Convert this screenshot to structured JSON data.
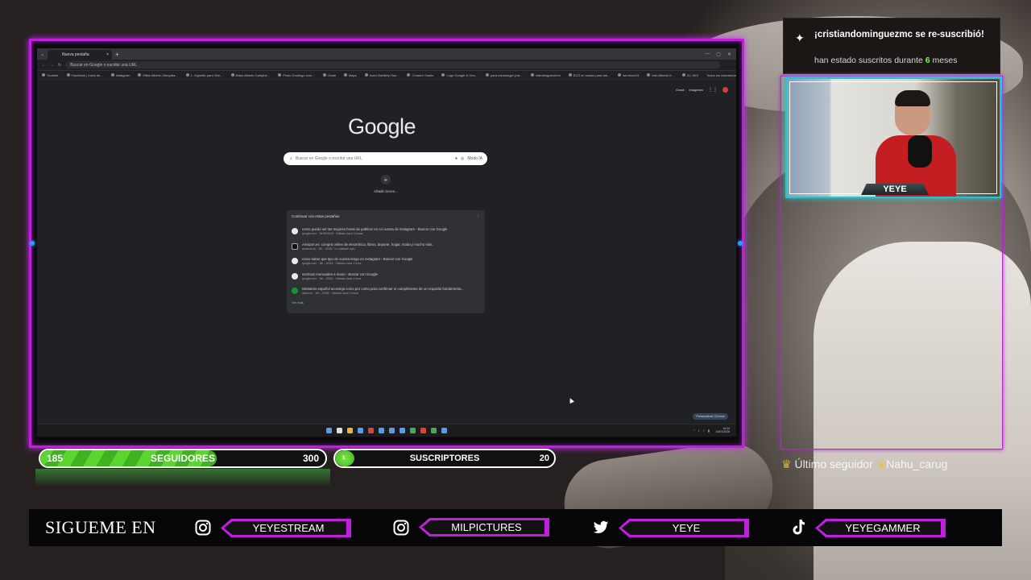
{
  "browser": {
    "tab_title": "Nueva pestaña",
    "omnibox_placeholder": "Buscar en Google o escribir una URL",
    "bookmarks": [
      "Youtube",
      "Facebook | Inicio de...",
      "Instagram",
      "Milan Alberto Zampala...",
      "1. Vignette para Stre...",
      "Milan Alberto Campbe...",
      "Photo Duolingo Icon...",
      "Gmail",
      "Maps",
      "Actor Bartleby Hus...",
      "Creador Studio",
      "Logo Google & Goo...",
      "para messenger pos...",
      "elamarsgaenenm",
      "ECS en ocasio para tak...",
      "servicios19",
      "Iván Alberto Il...",
      "DJ, MCl"
    ],
    "all_bookmarks": "Todos los marcadores",
    "google_links": [
      "Gmail",
      "Imágenes"
    ],
    "logo": "Google",
    "search_placeholder": "Buscar en Google o escribir una URL",
    "mode_chip": "Modo IA",
    "add_shortcut": "Añadir acces...",
    "continue_title": "Continuar con estas pestañas",
    "history": [
      {
        "title": "como puedo ver las mejores horas de publicar en mi cuenta de instagram - Buscar con Google",
        "sub": "google.com · 16:05/2026 · Visitado hace 3 horas"
      },
      {
        "title": "Amazon.es: compra online de electrónica, libros, deporte, hogar, moda y mucho más.",
        "sub": "amazon.es · 16/…/2026 · Lo visitaste ayer"
      },
      {
        "title": "como saber que tipo de cuenta tengo en instagram - Buscar con Google",
        "sub": "google.com · 16/…/2026 · Visitado hace 1 hora"
      },
      {
        "title": "sonrisas mensuales a mano - Buscar con Google",
        "sub": "google.com · 16/…/2026 · Visitado hace 1 hora"
      },
      {
        "title": "Ministerio español aconseja como por como para confirmar el cumplimiento de un requisito fundamenta...",
        "sub": "diario.es · 16/…/2026 · Visitado hace 2 horas"
      }
    ],
    "see_more": "Ver más",
    "customize": "Personalizar Chrome",
    "clock_time": "14:24",
    "clock_date": "14/01/2026"
  },
  "notification": {
    "star_icon": "sparkle-icon",
    "title": "¡cristiandominguezmc se re-suscribió!",
    "prefix": "han estado suscritos durante",
    "months": "6",
    "suffix": "meses"
  },
  "webcam": {
    "nameplate": "YEYE"
  },
  "last_follower": {
    "label": "Último seguidor",
    "name": "Nahu_carug"
  },
  "goals": {
    "followers": {
      "current": "185",
      "label": "SEGUIDORES",
      "target": "300",
      "progress": 0.62
    },
    "subs": {
      "current": "1",
      "label": "SUSCRIPTORES",
      "target": "20",
      "progress": 0.05
    }
  },
  "social": {
    "heading": "SIGUEME EN",
    "accounts": [
      {
        "icon": "instagram-icon",
        "handle": "YEYESTREAM"
      },
      {
        "icon": "instagram-icon",
        "handle": "MILPICTURES"
      },
      {
        "icon": "twitter-icon",
        "handle": "YEYE"
      },
      {
        "icon": "tiktok-icon",
        "handle": "YEYEGAMMER"
      }
    ]
  },
  "colors": {
    "neon_purple": "#c21ee0",
    "neon_cyan": "#1fc8cf",
    "goal_green": "#5bd52f",
    "highlight_green": "#6cff3a"
  }
}
